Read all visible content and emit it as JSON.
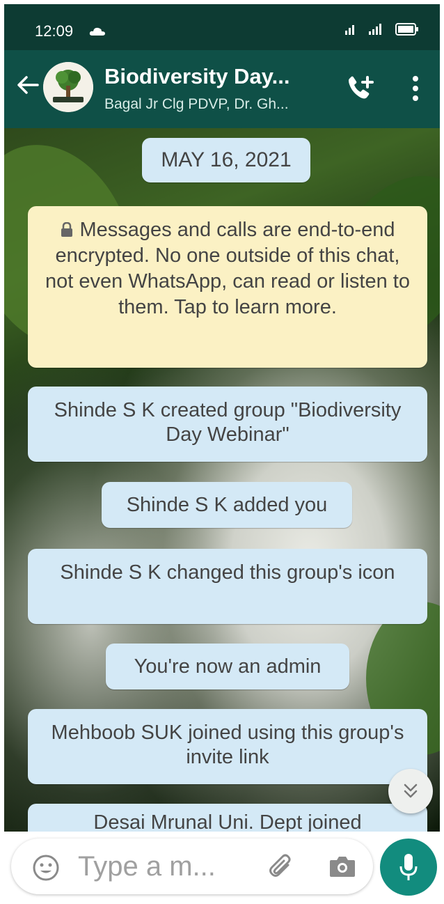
{
  "status_bar": {
    "time": "12:09"
  },
  "header": {
    "title": "Biodiversity Day...",
    "subtitle": "Bagal Jr Clg PDVP, Dr. Gh..."
  },
  "chat": {
    "date_chip": "MAY 16, 2021",
    "encryption_notice": "Messages and calls are end-to-end encrypted. No one outside of this chat, not even WhatsApp, can read or listen to them. Tap to learn more.",
    "system_messages": [
      "Shinde S K created group \"Biodiversity Day Webinar\"",
      "Shinde S K added you",
      "Shinde S K changed this group's icon",
      "You're now an admin",
      "Mehboob SUK joined using this group's invite link",
      "Desai Mrunal Uni. Dept joined"
    ]
  },
  "composer": {
    "placeholder": "Type a m..."
  },
  "colors": {
    "header": "#0f5047",
    "status_bar": "#0d3b33",
    "system_bubble": "#d4e9f6",
    "encryption_bubble": "#fbf1c4",
    "mic_button": "#128c7e"
  },
  "icons": [
    "cloud-icon",
    "signal-icon",
    "battery-icon",
    "back-arrow-icon",
    "add-call-icon",
    "more-vertical-icon",
    "lock-icon",
    "double-chevron-down-icon",
    "emoji-icon",
    "attachment-icon",
    "camera-icon",
    "microphone-icon"
  ]
}
